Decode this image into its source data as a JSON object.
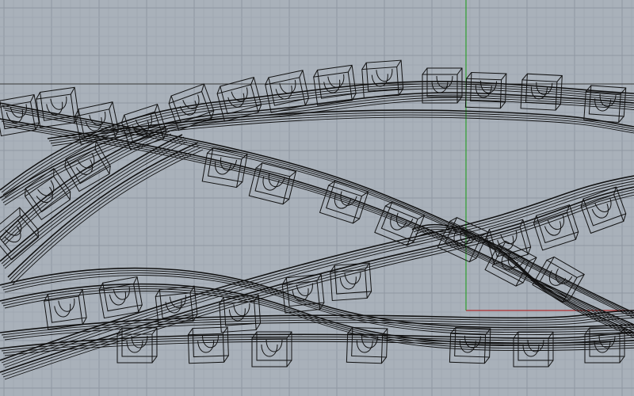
{
  "viewport": {
    "view_type": "wireframe-perspective",
    "background_color": "#a9b1ba",
    "grid_minor_color": "#9ea6b0",
    "grid_major_color": "#8f98a2",
    "wire_color": "#111111",
    "axis_x_color": "#b03030",
    "axis_y_color": "#2fa02f",
    "construction_plane_line_color": "#3a3a3a"
  },
  "geometry": {
    "description_type": "twisted-band-lattice",
    "band_count": 4,
    "module_icon": "wire-module-icon"
  }
}
